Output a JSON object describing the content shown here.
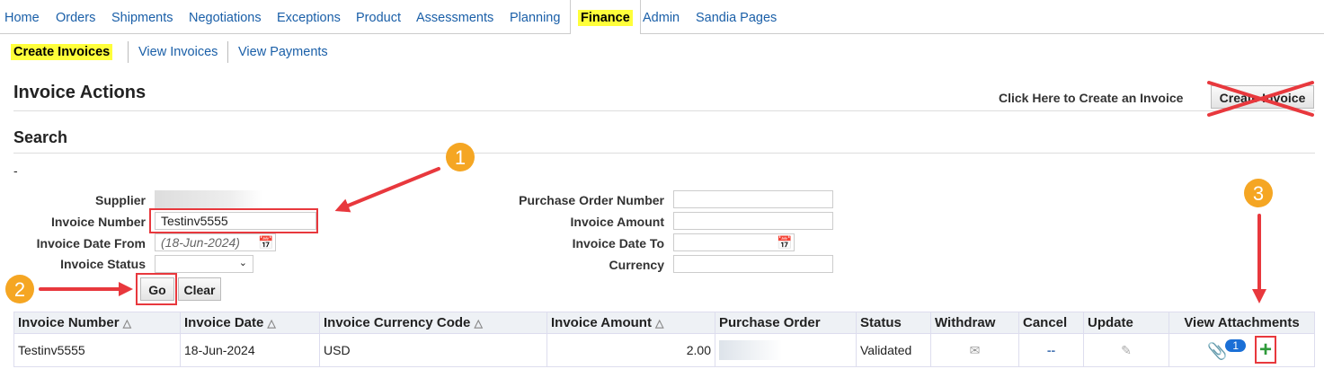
{
  "nav": {
    "tabs": [
      "Home",
      "Orders",
      "Shipments",
      "Negotiations",
      "Exceptions",
      "Product",
      "Assessments",
      "Planning",
      "Finance",
      "Admin",
      "Sandia Pages"
    ],
    "active": "Finance"
  },
  "subnav": {
    "items": [
      "Create Invoices",
      "View Invoices",
      "View Payments"
    ],
    "active": "Create Invoices"
  },
  "actions": {
    "title": "Invoice Actions",
    "hint": "Click Here to Create an Invoice",
    "create_button": "Create Invoice"
  },
  "search": {
    "title": "Search",
    "dash": "-",
    "fields": {
      "supplier": "Supplier",
      "invoice_number": "Invoice Number",
      "invoice_number_value": "Testinv5555",
      "date_from": "Invoice Date From",
      "date_from_placeholder": "(18-Jun-2024)",
      "status": "Invoice Status",
      "po_number": "Purchase Order Number",
      "amount": "Invoice Amount",
      "date_to": "Invoice Date To",
      "currency": "Currency"
    },
    "go": "Go",
    "clear": "Clear"
  },
  "table": {
    "headers": [
      "Invoice Number",
      "Invoice Date",
      "Invoice Currency Code",
      "Invoice Amount",
      "Purchase Order",
      "Status",
      "Withdraw",
      "Cancel",
      "Update",
      "View Attachments"
    ],
    "rows": [
      {
        "invoice_number": "Testinv5555",
        "invoice_date": "18-Jun-2024",
        "currency": "USD",
        "amount": "2.00",
        "status": "Validated",
        "attachment_count": "1"
      }
    ]
  },
  "annotations": {
    "steps": [
      "1",
      "2",
      "3"
    ],
    "color": "#e8383d",
    "badge_color": "#f5a623"
  }
}
